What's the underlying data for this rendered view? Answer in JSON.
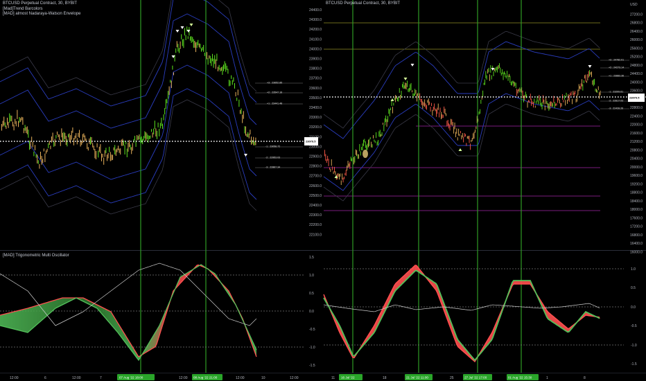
{
  "left_chart": {
    "title": "BTCUSD Perpetual Contract, 30, BYBIT",
    "indicators": [
      "[Mad]Trend Barcolors",
      "[MAD] almost Nadaraya-Watson Envelope"
    ],
    "price_axis": [
      "24400.0",
      "24300.0",
      "24200.0",
      "24100.0",
      "24000.0",
      "23900.0",
      "23800.0",
      "23700.0",
      "23600.0",
      "23500.0",
      "23400.0",
      "23300.0",
      "23200.0",
      "23100.0",
      "23000.0",
      "22900.0",
      "22800.0",
      "22700.0",
      "22600.0",
      "22500.0",
      "22400.0",
      "22300.0",
      "22200.0",
      "22100.0"
    ],
    "current_price": "23079.5",
    "levels": [
      {
        "label": "+3 : 23652.85"
      },
      {
        "label": "+2 : 23547.16"
      },
      {
        "label": "+1 : 23441.48"
      },
      {
        "label": "-1 : 23058.72"
      },
      {
        "label": "-2 : 22953.03"
      },
      {
        "label": "-3 : 22867.34"
      }
    ]
  },
  "right_chart": {
    "title": "BTCUSD Perpetual Contract, 30, BYBIT",
    "price_axis": [
      "USD",
      "27200.0",
      "26800.0",
      "26400.0",
      "26000.0",
      "25600.0",
      "25200.0",
      "24800.0",
      "24400.0",
      "24000.0",
      "23600.0",
      "23200.0",
      "22800.0",
      "22400.0",
      "22000.0",
      "21600.0",
      "21200.0",
      "20800.0",
      "20400.0",
      "20000.0",
      "19600.0",
      "19200.0",
      "18800.0",
      "18400.0",
      "18000.0",
      "17600.0",
      "17200.0",
      "16800.0",
      "16400.0",
      "16000.0"
    ],
    "current_price": "23079.5",
    "levels": [
      {
        "label": "+3 : 24782.01"
      },
      {
        "label": "+2 : 24273.14"
      },
      {
        "label": "+1 : 23883.36"
      },
      {
        "label": "-1 : 23209.61"
      },
      {
        "label": "-2 : 22817.03"
      },
      {
        "label": "-3 : 22428.26"
      }
    ]
  },
  "oscillator": {
    "title": "[MAD] Trigonometric Multi Oscillator",
    "left_axis": [
      "1.5",
      "1.0",
      "0.5",
      "0.0",
      "-0.5",
      "-1.0",
      "-1.5"
    ],
    "right_axis": [
      "1.0",
      "0.5",
      "0.0",
      "-0.5",
      "-1.0",
      "-1.5"
    ]
  },
  "left_time_axis": [
    "12:00",
    "6",
    "12:00",
    "7",
    "12:00",
    "18:00",
    "12:00",
    "18:00",
    "12:00",
    "10",
    "12:00"
  ],
  "left_time_tags": [
    "07 Aug '22   18:00",
    "08 Aug '22   21:00"
  ],
  "right_time_axis": [
    "11",
    "18",
    "25",
    "1",
    "8"
  ],
  "right_time_tags": [
    "16 Jul '22",
    "21 Jul '22   11:00",
    "27 Jul '22   17:00",
    "01 Aug '22   15:30"
  ],
  "colors": {
    "up_bar": "#5ee51f",
    "down_bar": "#e8b15a",
    "env_blue": "#2a3dbf",
    "env_outer": "#3a3a48",
    "osc_green": "#52c05a",
    "osc_red": "#ff4f4f",
    "vline": "#2f9d25",
    "level_magenta": "#7a1d7e",
    "level_olive": "#6d6a1d"
  }
}
